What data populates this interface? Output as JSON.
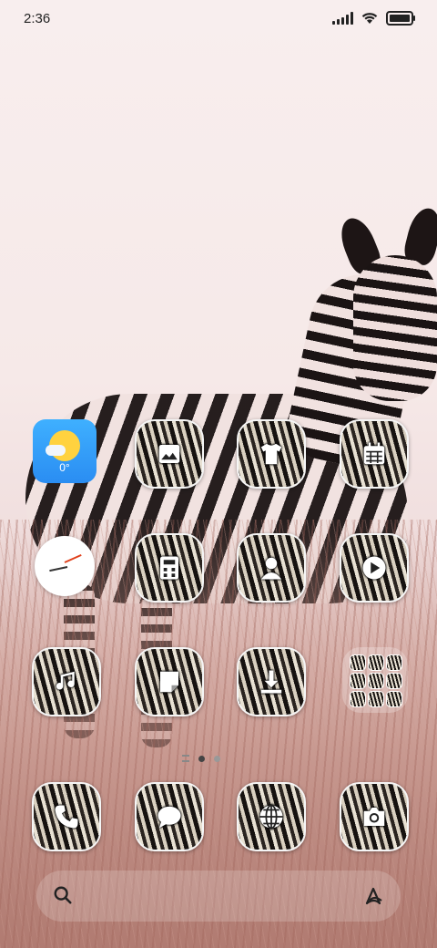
{
  "status_bar": {
    "time": "2:36",
    "icons": [
      "signal-icon",
      "wifi-icon",
      "battery-icon"
    ]
  },
  "widgets": {
    "weather": {
      "temperature": "0°",
      "icon": "partly-sunny-icon",
      "bg_color": "#2a8df2"
    },
    "clock": {
      "icon": "clock-icon"
    }
  },
  "apps": [
    {
      "name": "gallery",
      "icon": "photo-icon"
    },
    {
      "name": "themes",
      "icon": "tshirt-icon"
    },
    {
      "name": "calendar",
      "icon": "calendar-icon"
    },
    {
      "name": "calculator",
      "icon": "calculator-icon"
    },
    {
      "name": "contacts",
      "icon": "contact-icon"
    },
    {
      "name": "video",
      "icon": "play-icon"
    },
    {
      "name": "music",
      "icon": "music-note-icon"
    },
    {
      "name": "notes",
      "icon": "note-icon"
    },
    {
      "name": "downloads",
      "icon": "download-icon"
    },
    {
      "name": "tools-folder",
      "icon": "folder-icon"
    }
  ],
  "dock": [
    {
      "name": "phone",
      "icon": "phone-icon"
    },
    {
      "name": "messages",
      "icon": "chat-bubble-icon"
    },
    {
      "name": "browser",
      "icon": "globe-icon"
    },
    {
      "name": "camera",
      "icon": "camera-icon"
    }
  ],
  "pagination": {
    "current_page": 1,
    "page_count": 2
  },
  "search_bar": {
    "left_icon": "search-icon",
    "right_icon": "assistant-icon"
  }
}
